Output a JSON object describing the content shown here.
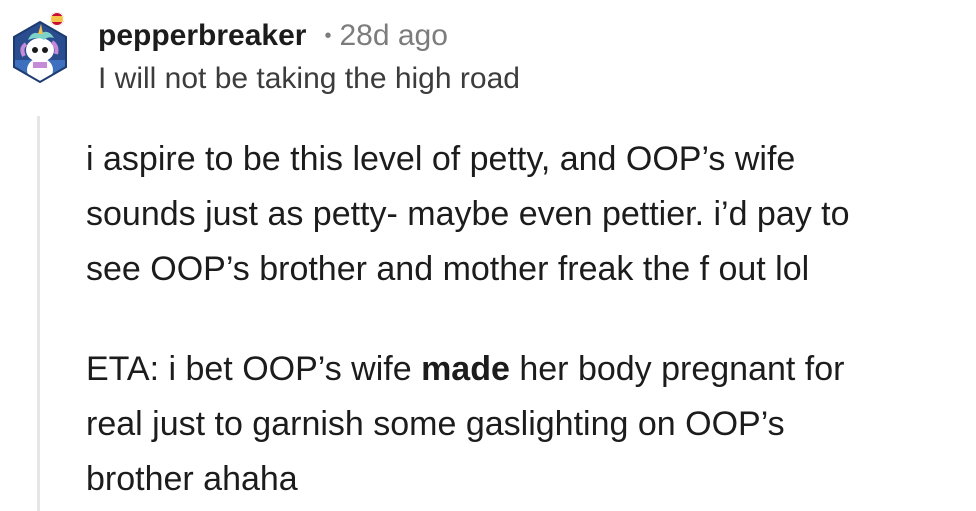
{
  "comment": {
    "author": "pepperbreaker",
    "separator": "•",
    "timestamp": "28d ago",
    "flair": "I will not be taking the high road",
    "avatar_icon": "snoo-unicorn-avatar-icon",
    "flag_icon": "spain-flag-icon",
    "paragraph1": {
      "line1": "i aspire to be this level of petty, and OOP’s wife",
      "line2": "sounds just as petty- maybe even pettier. i’d pay to",
      "line3": "see OOP’s brother and mother freak the f out lol"
    },
    "paragraph2": {
      "line1_before": "ETA: i bet OOP’s wife ",
      "line1_bold": "made",
      "line1_after": " her body pregnant for",
      "line2": "real just to garnish some gaslighting on OOP’s",
      "line3": "brother ahaha"
    }
  },
  "colors": {
    "text": "#1c1c1c",
    "meta": "#7c7c7c",
    "thread_line": "#e4e6e8",
    "avatar_bg": "#2a4d8f"
  }
}
